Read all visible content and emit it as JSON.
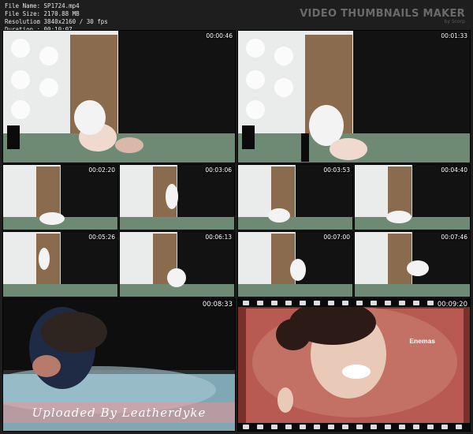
{
  "info": {
    "file_name_label": "File Name",
    "file_name": ": SP1724.mp4",
    "file_size_label": "File Size",
    "file_size": ": 2170.88 MB",
    "resolution_label": "Resolution",
    "resolution": ": 3840x2160 / 30 fps",
    "duration_label": "Duration",
    "duration": ": 00:10:07"
  },
  "brand": {
    "title": "VIDEO THUMBNAILS MAKER",
    "subtitle": "by Scorp"
  },
  "thumbs": [
    "00:00:46",
    "00:01:33",
    "00:02:20",
    "00:03:06",
    "00:03:53",
    "00:04:40",
    "00:05:26",
    "00:06:13",
    "00:07:00",
    "00:07:46",
    "00:08:33",
    "00:09:20"
  ],
  "watermark": "Uploaded By Leatherdyke",
  "overlay_tag": "Enemas"
}
